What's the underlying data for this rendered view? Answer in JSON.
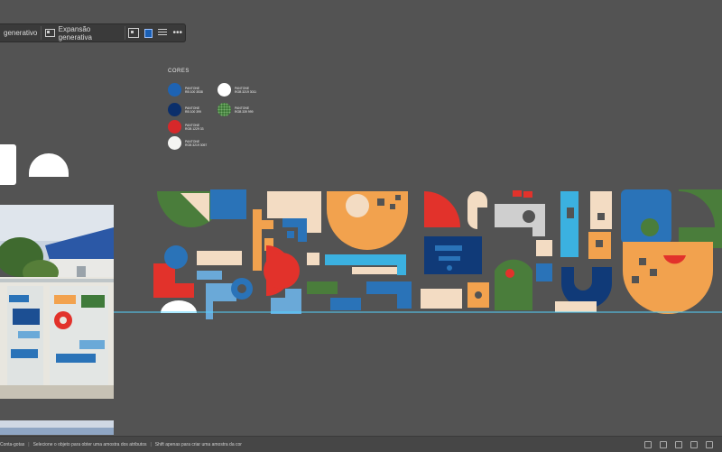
{
  "context_bar": {
    "btn1_label": "generativo",
    "btn2_label": "Expansão generativa",
    "more_label": "•••"
  },
  "legend": {
    "title": "CORES",
    "swatches": [
      {
        "color": "#1e63b3",
        "text": "PANTONE\nRB 100 3538"
      },
      {
        "color": "#0b2f6b",
        "text": "PANTONE\nRB 100 399"
      },
      {
        "color": "#d7282a",
        "text": "PANTONE\nRGB 1229 33"
      },
      {
        "color": "#f4f4f2",
        "text": "PANTONE\nRGB 3219 3057"
      },
      {
        "color": "#ffffff",
        "text": "PANTONE\nRGB 3219 3011"
      },
      {
        "color": "#3f7a3a",
        "text": "PANTONE\nRGB 339 999"
      }
    ]
  },
  "statusbar": {
    "part1": "Conta-gotas",
    "part2": "Selecione o objeto para obter uma amostra dos atributos",
    "part3": "Shift apenas para criar uma amostra da cor"
  },
  "colors": {
    "orange": "#f2a24e",
    "blue": "#2a73b8",
    "navy": "#103a78",
    "red": "#e2322b",
    "green": "#4a7d3b",
    "cream": "#f3dcc3",
    "cyan": "#3bb1e0",
    "lightblue": "#6aa9d8",
    "gray": "#cfcfcf",
    "guide": "#53d3ff"
  }
}
